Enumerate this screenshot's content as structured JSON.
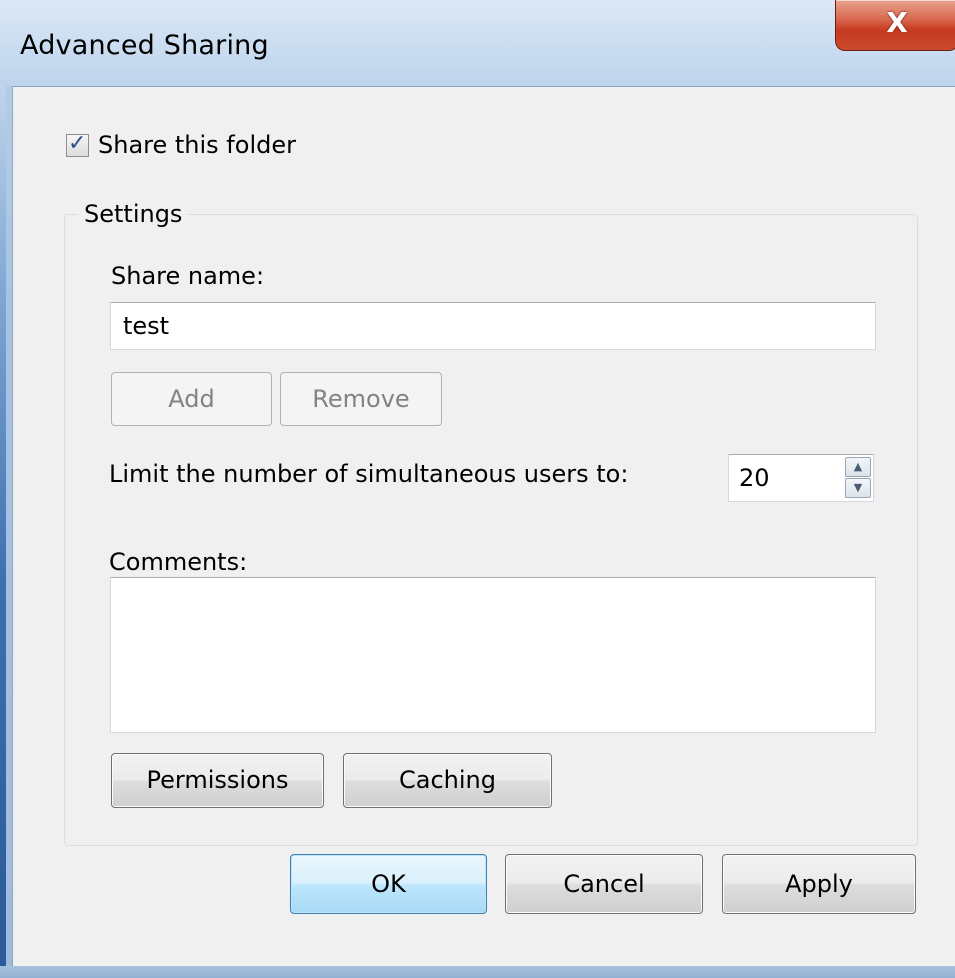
{
  "window": {
    "title": "Advanced Sharing",
    "close_glyph": "X"
  },
  "share": {
    "checkbox_label": "Share this folder",
    "checked": true
  },
  "settings": {
    "group_label": "Settings",
    "share_name_label": "Share name:",
    "share_name_value": "test",
    "add_label": "Add",
    "remove_label": "Remove",
    "limit_label": "Limit the number of simultaneous users to:",
    "limit_value": "20",
    "comments_label": "Comments:",
    "comments_value": "",
    "permissions_label": "Permissions",
    "caching_label": "Caching"
  },
  "footer": {
    "ok_label": "OK",
    "cancel_label": "Cancel",
    "apply_label": "Apply"
  },
  "icons": {
    "close": "close-icon",
    "check": "checkmark-icon",
    "spin_up": "arrow-up-icon",
    "spin_down": "arrow-down-icon"
  }
}
